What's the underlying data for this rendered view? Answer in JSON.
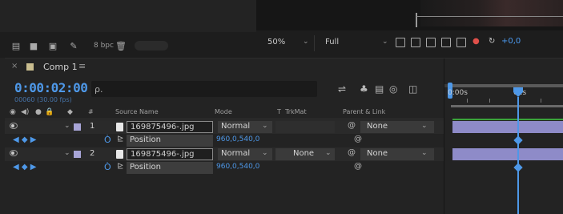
{
  "project_toolbar": {
    "bpc_label": "8 bpc"
  },
  "viewer_toolbar": {
    "zoom": "50%",
    "resolution": "Full",
    "exposure": "+0,0"
  },
  "timeline": {
    "tab_label": "Comp 1",
    "tab_menu": "≡",
    "timecode": "0:00:02:00",
    "fps": "00060 (30.00 fps)",
    "search_placeholder": "",
    "columns": {
      "num": "#",
      "source_name": "Source Name",
      "mode": "Mode",
      "t": "T",
      "trkmat": "TrkMat",
      "parent_link": "Parent & Link"
    },
    "layers": [
      {
        "num": "1",
        "name": "169875496-.jpg",
        "mode": "Normal",
        "trkmat": "",
        "parent": "None",
        "property": "Position",
        "value": "960,0,540,0"
      },
      {
        "num": "2",
        "name": "169875496-.jpg",
        "mode": "Normal",
        "trkmat": "None",
        "parent": "None",
        "property": "Position",
        "value": "960,0,540,0"
      }
    ],
    "ruler": {
      "start": "0:00s",
      "marker": "01s"
    }
  },
  "colors": {
    "accent": "#4e98e8",
    "layer_label": "#a7a4d6",
    "track_bar": "#8e8bc8",
    "comp_swatch": "#c9bd8f"
  }
}
